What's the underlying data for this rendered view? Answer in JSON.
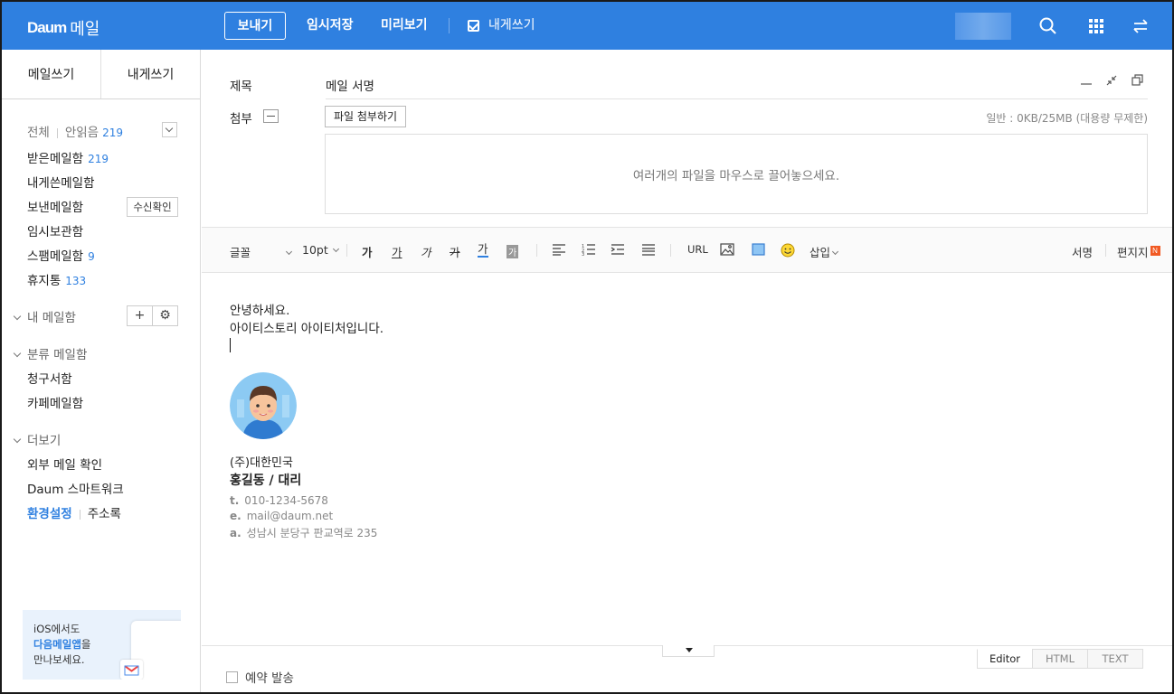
{
  "app": {
    "brand": "Daum",
    "service": "메일"
  },
  "topbar": {
    "send": "보내기",
    "save_draft": "임시저장",
    "preview": "미리보기",
    "self_write": "내게쓰기",
    "icons": [
      "search-icon",
      "apps-grid-icon",
      "switch-icon"
    ]
  },
  "sidebar": {
    "tabs": [
      "메일쓰기",
      "내게쓰기"
    ],
    "filter": {
      "all": "전체",
      "unread": "안읽음",
      "unread_count": "219"
    },
    "folders": [
      {
        "label": "받은메일함",
        "count": "219"
      },
      {
        "label": "내게쓴메일함",
        "count": ""
      },
      {
        "label": "보낸메일함",
        "count": ""
      },
      {
        "label": "임시보관함",
        "count": ""
      },
      {
        "label": "스팸메일함",
        "count": "9"
      },
      {
        "label": "휴지통",
        "count": "133"
      }
    ],
    "receipt_button": "수신확인",
    "my_mailbox": {
      "label": "내 메일함",
      "add": "+",
      "settings": "⚙"
    },
    "category": {
      "label": "분류 메일함",
      "items": [
        "청구서함",
        "카페메일함"
      ]
    },
    "more": {
      "label": "더보기",
      "items": [
        "외부 메일 확인",
        "Daum 스마트워크"
      ]
    },
    "settings_link": "환경설정",
    "address_book": "주소록",
    "promo": {
      "line1": "iOS에서도",
      "line2": "다음메일앱",
      "line2_suffix": "을",
      "line3": "만나보세요."
    }
  },
  "compose": {
    "subject_label": "제목",
    "subject_value": "메일 서명",
    "attach_label": "첨부",
    "attach_button": "파일 첨부하기",
    "usage": "일반 : 0KB/25MB (대용량 무제한)",
    "dropzone": "여러개의 파일을 마우스로 끌어놓으세요."
  },
  "toolbar": {
    "font": "글꼴",
    "size": "10pt",
    "bold": "가",
    "underline": "가",
    "italic": "가",
    "strike": "가",
    "font_color": "가",
    "bg_color": "가",
    "url": "URL",
    "insert": "삽입",
    "signature": "서명",
    "stationery": "편지지",
    "new_badge": "N"
  },
  "body": {
    "line1": "안녕하세요.",
    "line2": "아이티스토리 아이티처입니다."
  },
  "signature": {
    "company": "(주)대한민국",
    "name_title": "홍길동 / 대리",
    "phone_prefix": "t.",
    "phone": "010-1234-5678",
    "email_prefix": "e.",
    "email": "mail@daum.net",
    "address_prefix": "a.",
    "address": "성남시 분당구 판교역로 235"
  },
  "bottom": {
    "reserve": "예약 발송",
    "modes": [
      "Editor",
      "HTML",
      "TEXT"
    ],
    "active_mode": "Editor"
  },
  "colors": {
    "accent": "#2f80e0",
    "badge": "#f15a24"
  }
}
